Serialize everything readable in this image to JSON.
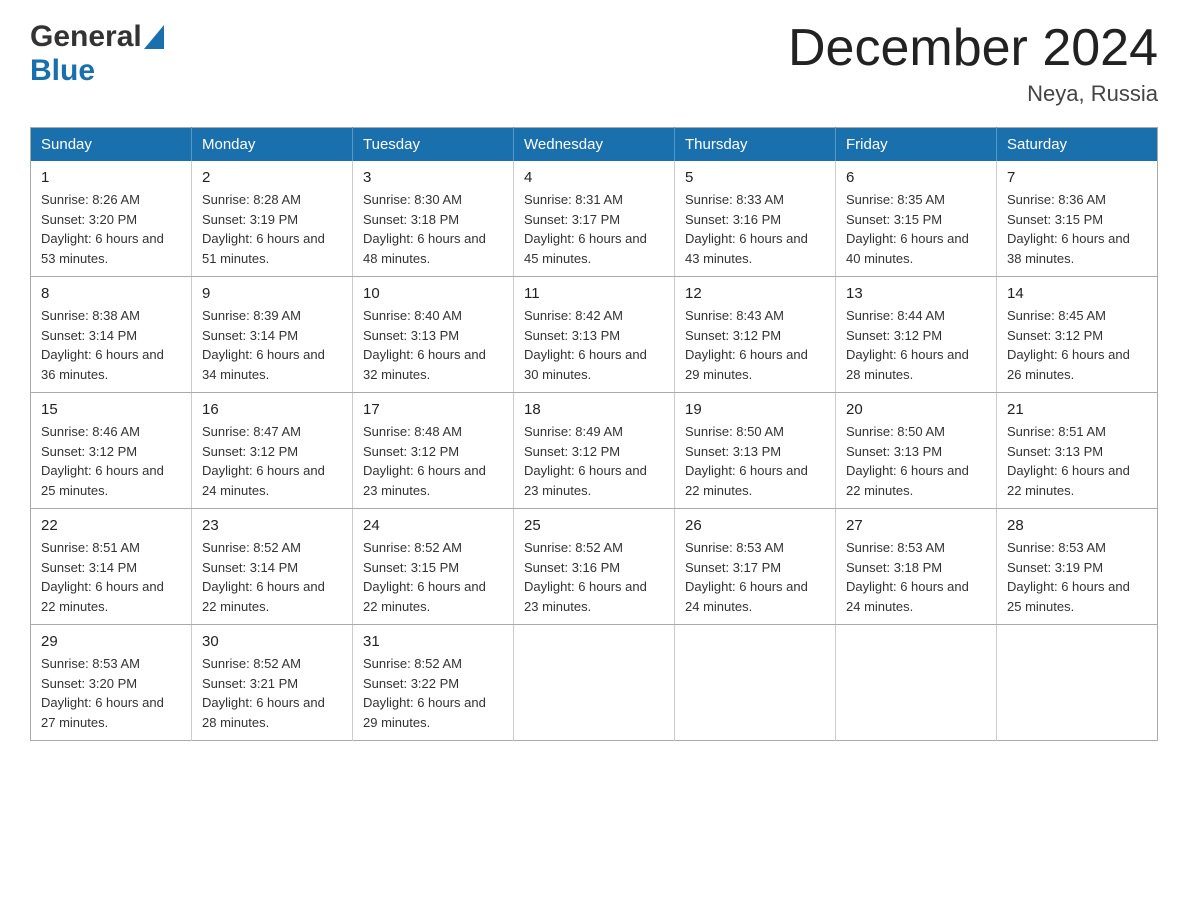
{
  "header": {
    "logo_general": "General",
    "logo_blue": "Blue",
    "title": "December 2024",
    "location": "Neya, Russia"
  },
  "calendar": {
    "days_of_week": [
      "Sunday",
      "Monday",
      "Tuesday",
      "Wednesday",
      "Thursday",
      "Friday",
      "Saturday"
    ],
    "weeks": [
      [
        {
          "day": "1",
          "sunrise": "8:26 AM",
          "sunset": "3:20 PM",
          "daylight": "6 hours and 53 minutes."
        },
        {
          "day": "2",
          "sunrise": "8:28 AM",
          "sunset": "3:19 PM",
          "daylight": "6 hours and 51 minutes."
        },
        {
          "day": "3",
          "sunrise": "8:30 AM",
          "sunset": "3:18 PM",
          "daylight": "6 hours and 48 minutes."
        },
        {
          "day": "4",
          "sunrise": "8:31 AM",
          "sunset": "3:17 PM",
          "daylight": "6 hours and 45 minutes."
        },
        {
          "day": "5",
          "sunrise": "8:33 AM",
          "sunset": "3:16 PM",
          "daylight": "6 hours and 43 minutes."
        },
        {
          "day": "6",
          "sunrise": "8:35 AM",
          "sunset": "3:15 PM",
          "daylight": "6 hours and 40 minutes."
        },
        {
          "day": "7",
          "sunrise": "8:36 AM",
          "sunset": "3:15 PM",
          "daylight": "6 hours and 38 minutes."
        }
      ],
      [
        {
          "day": "8",
          "sunrise": "8:38 AM",
          "sunset": "3:14 PM",
          "daylight": "6 hours and 36 minutes."
        },
        {
          "day": "9",
          "sunrise": "8:39 AM",
          "sunset": "3:14 PM",
          "daylight": "6 hours and 34 minutes."
        },
        {
          "day": "10",
          "sunrise": "8:40 AM",
          "sunset": "3:13 PM",
          "daylight": "6 hours and 32 minutes."
        },
        {
          "day": "11",
          "sunrise": "8:42 AM",
          "sunset": "3:13 PM",
          "daylight": "6 hours and 30 minutes."
        },
        {
          "day": "12",
          "sunrise": "8:43 AM",
          "sunset": "3:12 PM",
          "daylight": "6 hours and 29 minutes."
        },
        {
          "day": "13",
          "sunrise": "8:44 AM",
          "sunset": "3:12 PM",
          "daylight": "6 hours and 28 minutes."
        },
        {
          "day": "14",
          "sunrise": "8:45 AM",
          "sunset": "3:12 PM",
          "daylight": "6 hours and 26 minutes."
        }
      ],
      [
        {
          "day": "15",
          "sunrise": "8:46 AM",
          "sunset": "3:12 PM",
          "daylight": "6 hours and 25 minutes."
        },
        {
          "day": "16",
          "sunrise": "8:47 AM",
          "sunset": "3:12 PM",
          "daylight": "6 hours and 24 minutes."
        },
        {
          "day": "17",
          "sunrise": "8:48 AM",
          "sunset": "3:12 PM",
          "daylight": "6 hours and 23 minutes."
        },
        {
          "day": "18",
          "sunrise": "8:49 AM",
          "sunset": "3:12 PM",
          "daylight": "6 hours and 23 minutes."
        },
        {
          "day": "19",
          "sunrise": "8:50 AM",
          "sunset": "3:13 PM",
          "daylight": "6 hours and 22 minutes."
        },
        {
          "day": "20",
          "sunrise": "8:50 AM",
          "sunset": "3:13 PM",
          "daylight": "6 hours and 22 minutes."
        },
        {
          "day": "21",
          "sunrise": "8:51 AM",
          "sunset": "3:13 PM",
          "daylight": "6 hours and 22 minutes."
        }
      ],
      [
        {
          "day": "22",
          "sunrise": "8:51 AM",
          "sunset": "3:14 PM",
          "daylight": "6 hours and 22 minutes."
        },
        {
          "day": "23",
          "sunrise": "8:52 AM",
          "sunset": "3:14 PM",
          "daylight": "6 hours and 22 minutes."
        },
        {
          "day": "24",
          "sunrise": "8:52 AM",
          "sunset": "3:15 PM",
          "daylight": "6 hours and 22 minutes."
        },
        {
          "day": "25",
          "sunrise": "8:52 AM",
          "sunset": "3:16 PM",
          "daylight": "6 hours and 23 minutes."
        },
        {
          "day": "26",
          "sunrise": "8:53 AM",
          "sunset": "3:17 PM",
          "daylight": "6 hours and 24 minutes."
        },
        {
          "day": "27",
          "sunrise": "8:53 AM",
          "sunset": "3:18 PM",
          "daylight": "6 hours and 24 minutes."
        },
        {
          "day": "28",
          "sunrise": "8:53 AM",
          "sunset": "3:19 PM",
          "daylight": "6 hours and 25 minutes."
        }
      ],
      [
        {
          "day": "29",
          "sunrise": "8:53 AM",
          "sunset": "3:20 PM",
          "daylight": "6 hours and 27 minutes."
        },
        {
          "day": "30",
          "sunrise": "8:52 AM",
          "sunset": "3:21 PM",
          "daylight": "6 hours and 28 minutes."
        },
        {
          "day": "31",
          "sunrise": "8:52 AM",
          "sunset": "3:22 PM",
          "daylight": "6 hours and 29 minutes."
        },
        null,
        null,
        null,
        null
      ]
    ]
  }
}
